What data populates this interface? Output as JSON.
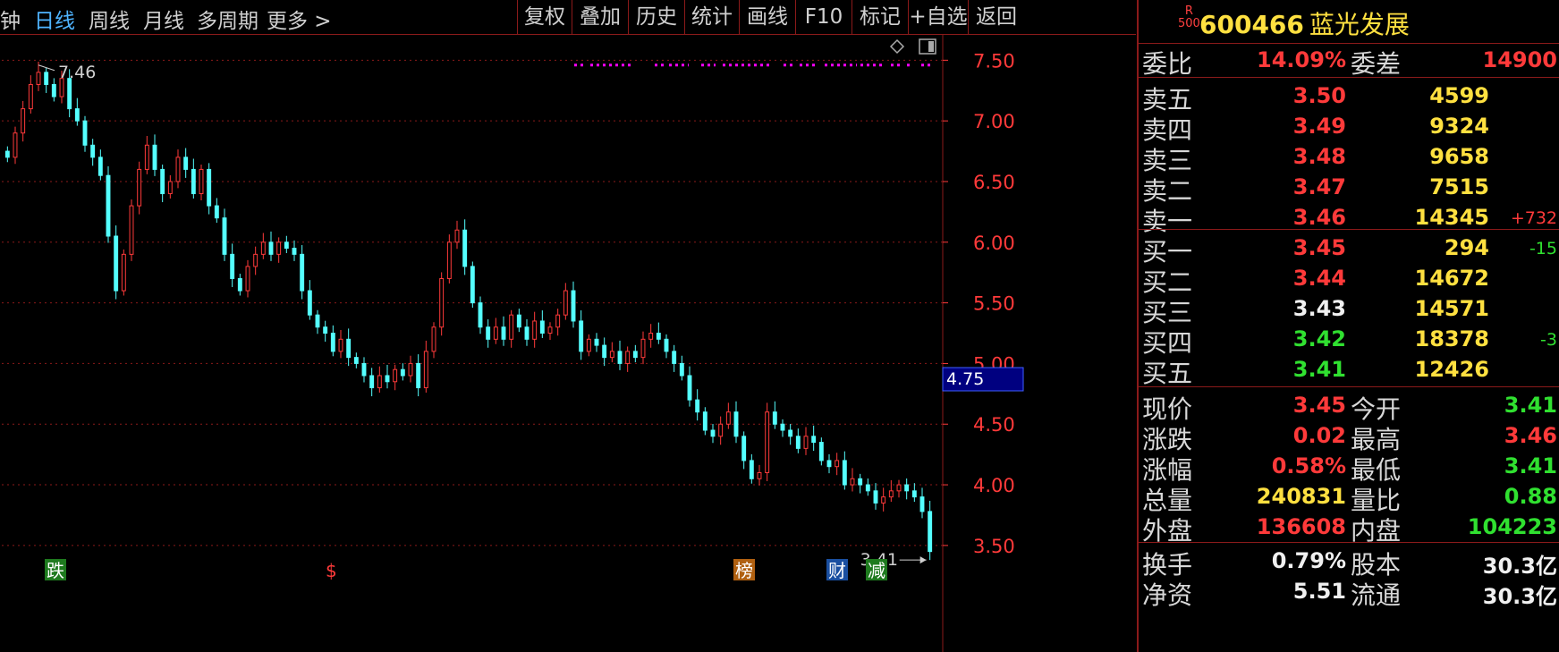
{
  "toolbar": {
    "tabs": [
      "钟",
      "日线",
      "周线",
      "月线",
      "多周期",
      "更多 >"
    ],
    "active_tab": "日线",
    "buttons": [
      "复权",
      "叠加",
      "历史",
      "统计",
      "画线",
      "F10",
      "标记",
      "+自选",
      "返回"
    ]
  },
  "quote": {
    "badge_top": "R",
    "badge_bottom": "500",
    "code": "600466",
    "name": "蓝光发展",
    "webi_label": "委比",
    "webi_value": "14.09%",
    "weicha_label": "委差",
    "weicha_value": "14900",
    "sell": [
      {
        "label": "卖五",
        "price": "3.50",
        "vol": "4599",
        "chg": ""
      },
      {
        "label": "卖四",
        "price": "3.49",
        "vol": "9324",
        "chg": ""
      },
      {
        "label": "卖三",
        "price": "3.48",
        "vol": "9658",
        "chg": ""
      },
      {
        "label": "卖二",
        "price": "3.47",
        "vol": "7515",
        "chg": ""
      },
      {
        "label": "卖一",
        "price": "3.46",
        "vol": "14345",
        "chg": "+732"
      }
    ],
    "buy": [
      {
        "label": "买一",
        "price": "3.45",
        "vol": "294",
        "chg": "-15"
      },
      {
        "label": "买二",
        "price": "3.44",
        "vol": "14672",
        "chg": ""
      },
      {
        "label": "买三",
        "price": "3.43",
        "vol": "14571",
        "chg": ""
      },
      {
        "label": "买四",
        "price": "3.42",
        "vol": "18378",
        "chg": "-3"
      },
      {
        "label": "买五",
        "price": "3.41",
        "vol": "12426",
        "chg": ""
      }
    ],
    "stats": [
      {
        "l1": "现价",
        "v1": "3.45",
        "l2": "今开",
        "v2": "3.41"
      },
      {
        "l1": "涨跌",
        "v1": "0.02",
        "l2": "最高",
        "v2": "3.46"
      },
      {
        "l1": "涨幅",
        "v1": "0.58%",
        "l2": "最低",
        "v2": "3.41"
      },
      {
        "l1": "总量",
        "v1": "240831",
        "l2": "量比",
        "v2": "0.88"
      },
      {
        "l1": "外盘",
        "v1": "136608",
        "l2": "内盘",
        "v2": "104223"
      }
    ],
    "stats2": [
      {
        "l1": "换手",
        "v1": "0.79%",
        "l2": "股本",
        "v2": "30.3亿"
      },
      {
        "l1": "净资",
        "v1": "5.51",
        "l2": "流通",
        "v2": "30.3亿"
      }
    ]
  },
  "chart_data": {
    "type": "candlestick",
    "y_ticks": [
      "7.50",
      "7.00",
      "6.50",
      "6.00",
      "5.50",
      "5.00",
      "4.50",
      "4.00",
      "3.50"
    ],
    "ylim": [
      3.3,
      7.65
    ],
    "crosshair_label": "4.75",
    "high_label": "7.46",
    "low_label": "3.41",
    "markers": [
      "跌",
      "$",
      "榜",
      "财",
      "减"
    ],
    "colors": {
      "up": "#ff3a3a",
      "down": "#54ffff",
      "grid": "#8b1a1a",
      "axis": "#ff3a3a",
      "dots": "#ff00ff"
    },
    "close": [
      6.7,
      6.9,
      7.1,
      7.3,
      7.4,
      7.3,
      7.2,
      7.35,
      7.1,
      7.0,
      6.8,
      6.7,
      6.55,
      6.05,
      5.6,
      5.9,
      6.3,
      6.6,
      6.8,
      6.6,
      6.4,
      6.5,
      6.7,
      6.6,
      6.4,
      6.6,
      6.3,
      6.2,
      5.9,
      5.7,
      5.6,
      5.8,
      5.9,
      6.0,
      5.9,
      6.0,
      5.95,
      5.9,
      5.6,
      5.4,
      5.3,
      5.25,
      5.1,
      5.2,
      5.05,
      5.0,
      4.9,
      4.8,
      4.9,
      4.85,
      4.95,
      4.9,
      5.0,
      4.8,
      5.1,
      5.3,
      5.7,
      6.0,
      6.1,
      5.8,
      5.5,
      5.3,
      5.2,
      5.3,
      5.2,
      5.4,
      5.3,
      5.2,
      5.35,
      5.25,
      5.3,
      5.4,
      5.6,
      5.35,
      5.1,
      5.2,
      5.15,
      5.05,
      5.1,
      5.0,
      5.1,
      5.05,
      5.2,
      5.25,
      5.2,
      5.1,
      5.0,
      4.9,
      4.7,
      4.6,
      4.45,
      4.4,
      4.5,
      4.6,
      4.4,
      4.2,
      4.05,
      4.1,
      4.6,
      4.5,
      4.45,
      4.4,
      4.3,
      4.4,
      4.35,
      4.2,
      4.15,
      4.2,
      4.0,
      4.05,
      4.0,
      3.95,
      3.85,
      3.9,
      3.95,
      4.0,
      3.95,
      3.9,
      3.78,
      3.45
    ]
  }
}
